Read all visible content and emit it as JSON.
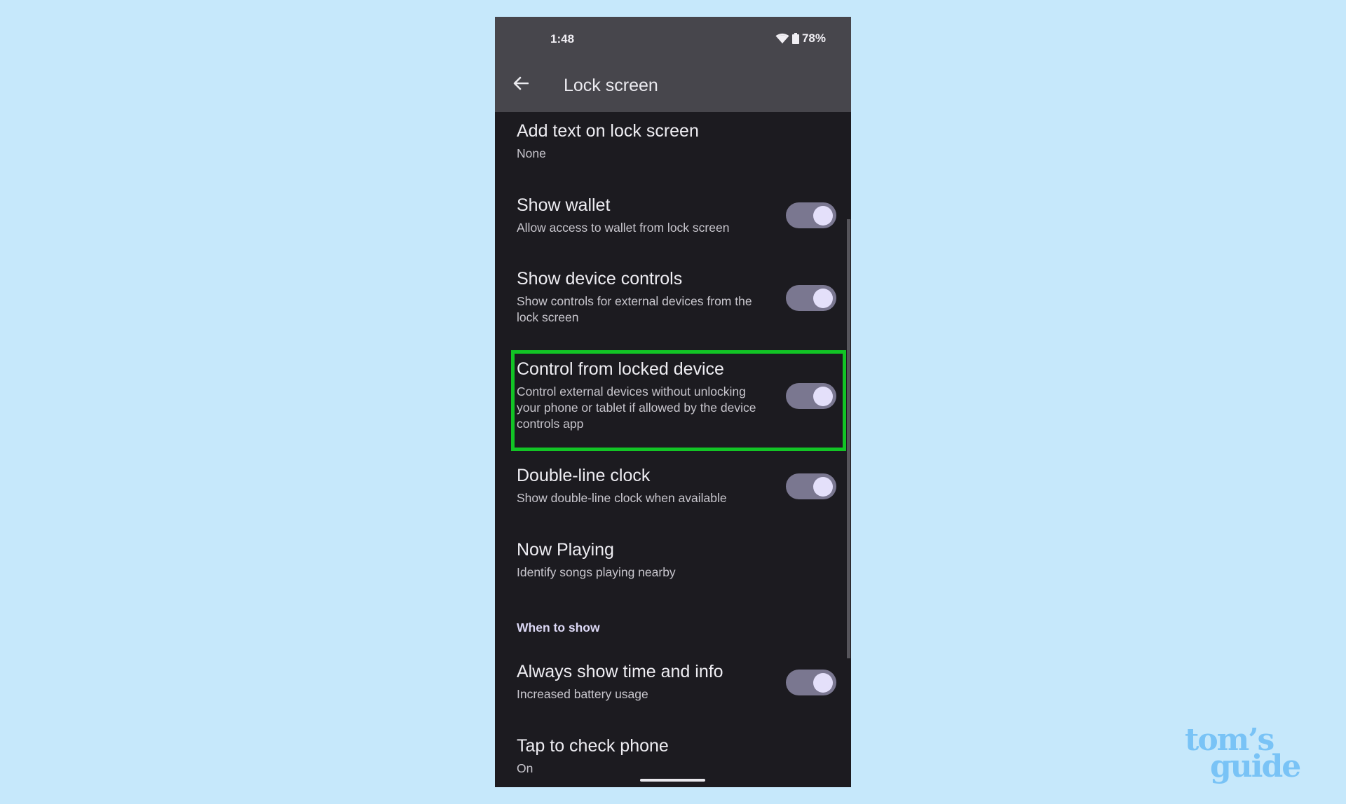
{
  "status_bar": {
    "time": "1:48",
    "battery_percent": "78%",
    "icons": [
      "wifi-icon",
      "battery-icon"
    ]
  },
  "app_bar": {
    "back_icon": "arrow-left-icon",
    "title": "Lock screen"
  },
  "settings": [
    {
      "title": "Add text on lock screen",
      "subtitle": "None",
      "toggle": null
    },
    {
      "title": "Show wallet",
      "subtitle": "Allow access to wallet from lock screen",
      "toggle": true
    },
    {
      "title": "Show device controls",
      "subtitle": "Show controls for external devices from the lock screen",
      "toggle": true
    },
    {
      "title": "Control from locked device",
      "subtitle": "Control external devices without unlocking your phone or tablet if allowed by the device controls app",
      "toggle": true,
      "highlighted": true
    },
    {
      "title": "Double-line clock",
      "subtitle": "Show double-line clock when available",
      "toggle": true
    },
    {
      "title": "Now Playing",
      "subtitle": "Identify songs playing nearby",
      "toggle": null
    }
  ],
  "section": {
    "label": "When to show",
    "items": [
      {
        "title": "Always show time and info",
        "subtitle": "Increased battery usage",
        "toggle": true
      },
      {
        "title": "Tap to check phone",
        "subtitle": "On",
        "toggle": null
      }
    ]
  },
  "highlight_color": "#12c425",
  "watermark": {
    "line1": "tom’s",
    "line2": "guide"
  }
}
